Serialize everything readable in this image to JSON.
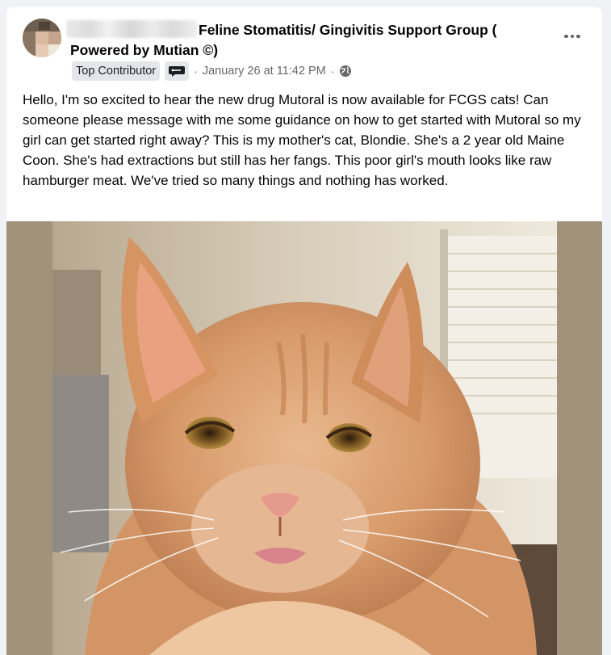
{
  "post": {
    "group_name": "Feline Stomatitis/ Gingivitis Support Group ( Powered by Mutian ©)",
    "badge_label": "Top Contributor",
    "badge_icon": "contributor-badge-icon",
    "separator": "·",
    "timestamp": "January 26 at 11:42 PM",
    "audience_icon": "globe-icon",
    "more_icon": "more-options-icon",
    "body": "Hello, I'm so excited to hear the new drug Mutoral is now available for FCGS cats! Can someone please message with me some guidance on how to get started with Mutoral so my girl can get started right away? This is my mother's cat, Blondie. She's a 2 year old Maine Coon. She's had extractions but still has her fangs. This poor girl's mouth looks like raw hamburger meat. We've tried so many things and nothing has worked."
  },
  "colors": {
    "page_background": "#f0f2f5",
    "card_background": "#ffffff",
    "secondary_text": "#65676b",
    "badge_background": "#e4e6eb",
    "media_frame": "#a1927c"
  }
}
